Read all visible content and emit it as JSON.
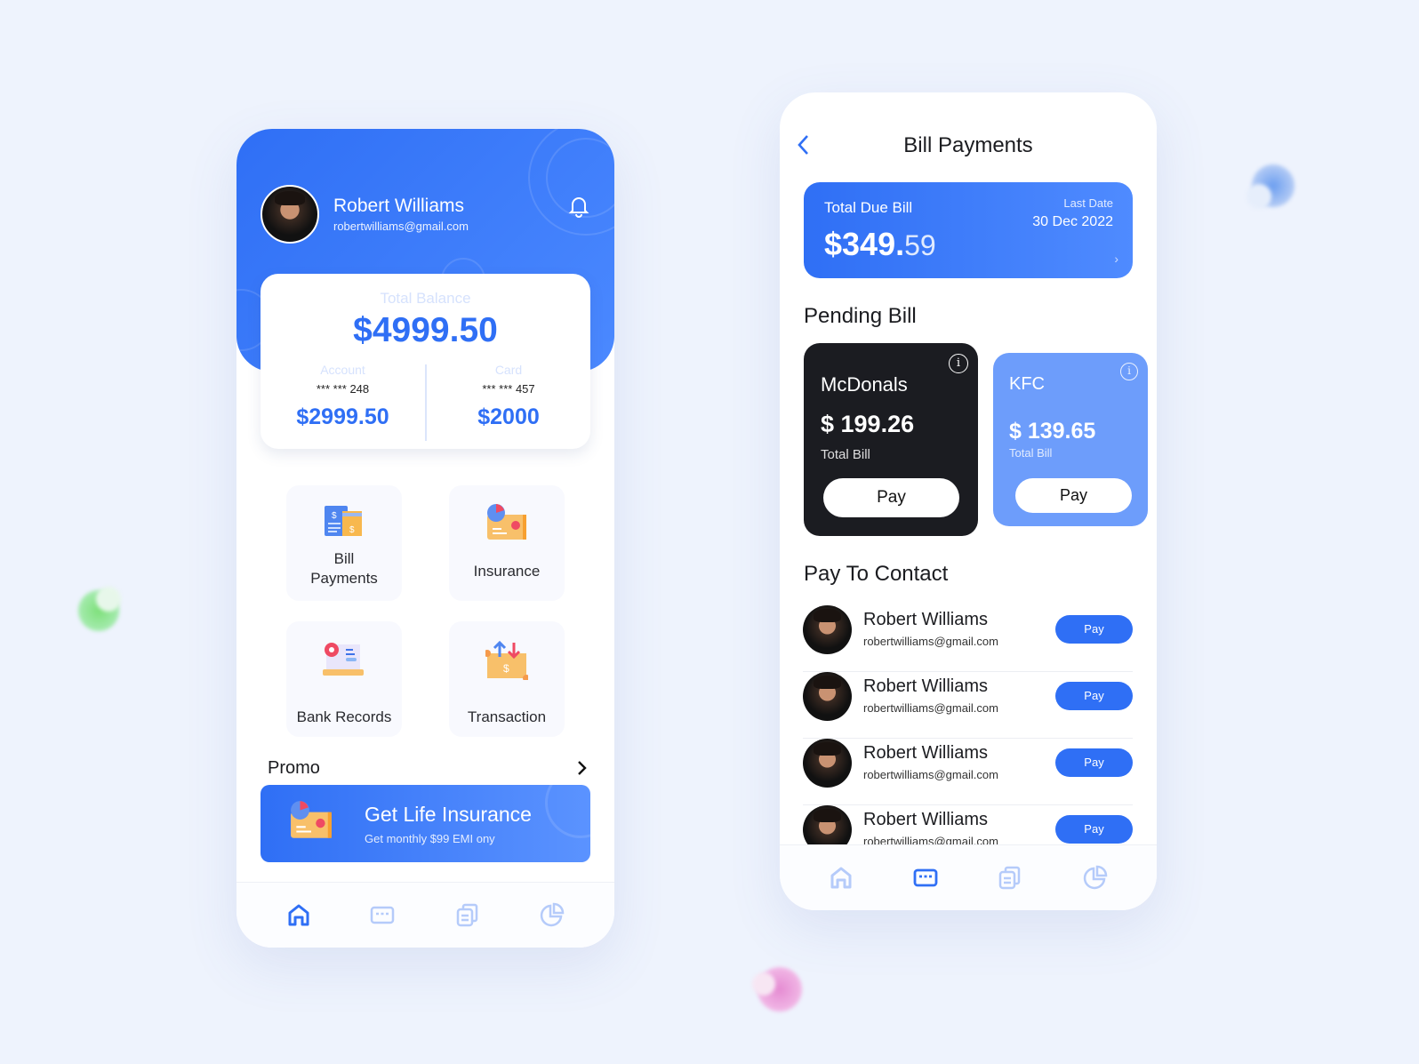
{
  "home": {
    "user": {
      "name": "Robert Williams",
      "email": "robertwilliams@gmail.com"
    },
    "balance": {
      "label": "Total Balance",
      "amount": "$4999.50",
      "account": {
        "label": "Account",
        "number": "*** *** 248",
        "amount": "$2999.50"
      },
      "card": {
        "label": "Card",
        "number": "*** *** 457",
        "amount": "$2000"
      }
    },
    "tiles": [
      {
        "label": "Bill",
        "label2": "Payments",
        "icon": "bill-icon"
      },
      {
        "label": "Insurance",
        "icon": "insurance-icon"
      },
      {
        "label": "Bank Records",
        "icon": "bank-records-icon"
      },
      {
        "label": "Transaction",
        "icon": "transaction-icon"
      }
    ],
    "promo": {
      "label": "Promo",
      "title": "Get Life Insurance",
      "subtitle": "Get monthly $99 EMI ony"
    },
    "nav": [
      "home-icon",
      "card-icon",
      "documents-icon",
      "pie-chart-icon"
    ],
    "active_nav": "home"
  },
  "bills": {
    "title": "Bill Payments",
    "due": {
      "label": "Total Due Bill",
      "amount_main": "$349.",
      "amount_cents": "59",
      "last_date_label": "Last Date",
      "last_date": "30 Dec 2022"
    },
    "pending_title": "Pending Bill",
    "pending": [
      {
        "name": "McDonals",
        "amount": "$ 199.26",
        "sub": "Total Bill",
        "pay": "Pay",
        "color": "#1b1c21"
      },
      {
        "name": "KFC",
        "amount": "$ 139.65",
        "sub": "Total Bill",
        "pay": "Pay",
        "color": "#6d9dfb"
      }
    ],
    "contacts_title": "Pay To Contact",
    "contacts": [
      {
        "name": "Robert Williams",
        "email": "robertwilliams@gmail.com",
        "pay": "Pay"
      },
      {
        "name": "Robert Williams",
        "email": "robertwilliams@gmail.com",
        "pay": "Pay"
      },
      {
        "name": "Robert Williams",
        "email": "robertwilliams@gmail.com",
        "pay": "Pay"
      },
      {
        "name": "Robert Williams",
        "email": "robertwilliams@gmail.com",
        "pay": "Pay"
      }
    ],
    "active_nav": "card"
  },
  "colors": {
    "accent": "#2f6ff5",
    "background": "#eef3fd",
    "dark_card": "#1b1c21",
    "light_blue_card": "#6d9dfb"
  }
}
